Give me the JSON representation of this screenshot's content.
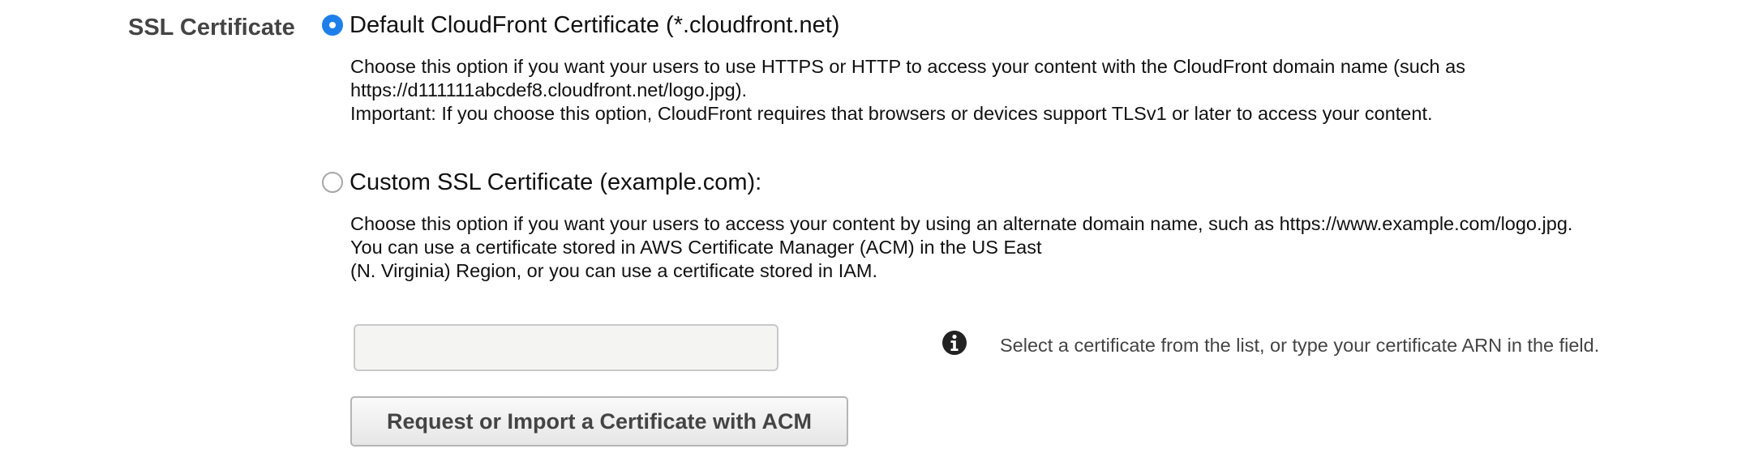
{
  "ssl_certificate": {
    "field_label": "SSL Certificate",
    "selected_option": "default",
    "default_option": {
      "label": "Default CloudFront Certificate (*.cloudfront.net)",
      "description_lines": [
        "Choose this option if you want your users to use HTTPS or HTTP to access your content with the CloudFront domain name (such as",
        "https://d111111abcdef8.cloudfront.net/logo.jpg).",
        "Important: If you choose this option, CloudFront requires that browsers or devices support TLSv1 or later to access your content."
      ]
    },
    "custom_option": {
      "label": "Custom SSL Certificate (example.com):",
      "description_lines": [
        "Choose this option if you want your users to access your content by using an alternate domain name, such as https://www.example.com/logo.jpg.",
        "You can use a certificate stored in AWS Certificate Manager (ACM) in the US East",
        "(N. Virginia) Region, or you can use a certificate stored in IAM."
      ]
    },
    "certificate_input": {
      "value": "",
      "placeholder": ""
    },
    "info_hint": {
      "icon": "info-icon",
      "text": "Select a certificate from the list, or type your certificate ARN in the field."
    },
    "acm_button_label": "Request or Import a Certificate with ACM"
  },
  "colors": {
    "radio_selected": "#1f7fea",
    "label_gray": "#444444",
    "input_background": "#f4f4f2"
  }
}
